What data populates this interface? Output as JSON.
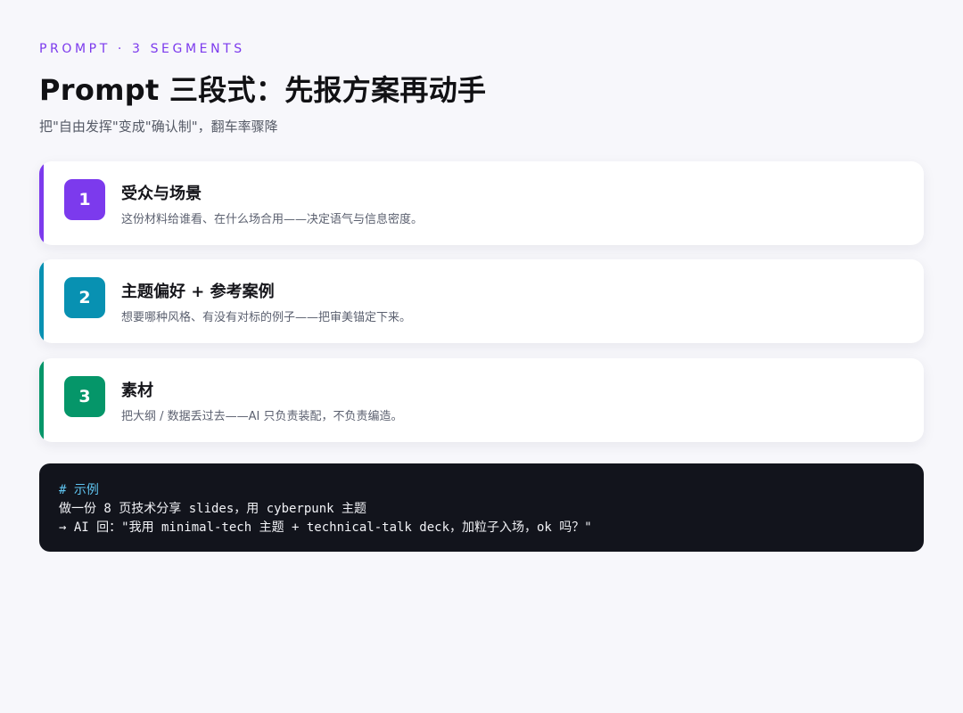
{
  "header": {
    "eyebrow": "PROMPT · 3 SEGMENTS",
    "title": "Prompt 三段式：先报方案再动手",
    "subtitle": "把\"自由发挥\"变成\"确认制\"，翻车率骤降"
  },
  "colors": {
    "purple": "#7c3aed",
    "teal": "#0891b2",
    "green": "#059669",
    "code_bg": "#12141c",
    "code_comment": "#5fc4f0"
  },
  "segments": [
    {
      "number": "1",
      "title": "受众与场景",
      "description": "这份材料给谁看、在什么场合用——决定语气与信息密度。"
    },
    {
      "number": "2",
      "title": "主题偏好 + 参考案例",
      "description": "想要哪种风格、有没有对标的例子——把审美锚定下来。"
    },
    {
      "number": "3",
      "title": "素材",
      "description": "把大纲 / 数据丢过去——AI 只负责装配，不负责编造。"
    }
  ],
  "example": {
    "comment": "# 示例",
    "line1": "做一份 8 页技术分享 slides，用 cyberpunk 主题",
    "line2": "→ AI 回：\"我用 minimal-tech 主题 + technical-talk deck，加粒子入场，ok 吗？\""
  }
}
